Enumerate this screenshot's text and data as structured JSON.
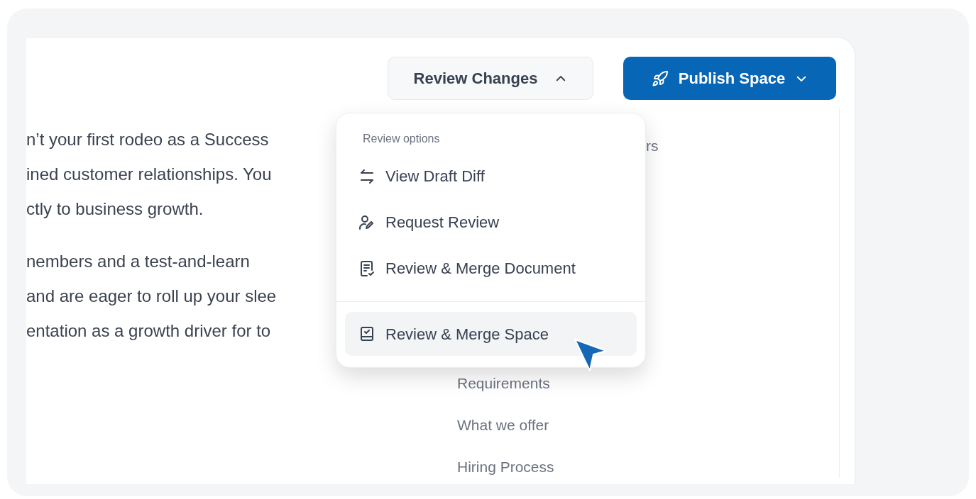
{
  "toolbar": {
    "review_button": {
      "label": "Review Changes",
      "expanded": true
    },
    "publish_button": {
      "label": "Publish Space"
    }
  },
  "body_text": {
    "paragraphs": [
      [
        "n’t your first rodeo as a Success",
        "ined customer relationships. You",
        "ctly to business growth."
      ],
      [
        "nembers and a test-and-learn",
        "and are eager to roll up your slee",
        "entation as a growth driver for to"
      ]
    ]
  },
  "outline": {
    "items": [
      "rs",
      "Requirements",
      "What we offer",
      "Hiring Process"
    ]
  },
  "review_menu": {
    "heading": "Review options",
    "items": [
      {
        "label": "View Draft Diff",
        "selected": false
      },
      {
        "label": "Request Review",
        "selected": false
      },
      {
        "label": "Review & Merge Document",
        "selected": false
      },
      {
        "label": "Review & Merge Space",
        "selected": true
      }
    ]
  }
}
